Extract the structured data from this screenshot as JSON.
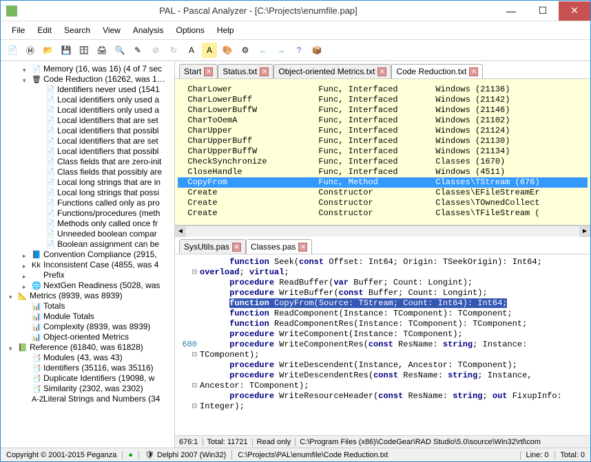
{
  "window": {
    "title": "PAL - Pascal Analyzer - [C:\\Projects\\enumfile.pap]"
  },
  "menu": [
    "File",
    "Edit",
    "Search",
    "View",
    "Analysis",
    "Options",
    "Help"
  ],
  "tree": [
    {
      "indent": 3,
      "toggle": "▾",
      "icon": "📄",
      "label": "Memory (16, was 16) (4 of 7 sec"
    },
    {
      "indent": 3,
      "toggle": "▾",
      "icon": "🗑",
      "label": "Code Reduction (16262, was 1…"
    },
    {
      "indent": 5,
      "toggle": "",
      "icon": "📄",
      "label": "Identifiers never used (1541"
    },
    {
      "indent": 5,
      "toggle": "",
      "icon": "📄",
      "label": "Local identifiers only used a"
    },
    {
      "indent": 5,
      "toggle": "",
      "icon": "📄",
      "label": "Local identifiers only used a"
    },
    {
      "indent": 5,
      "toggle": "",
      "icon": "📄",
      "label": "Local identifiers that are set"
    },
    {
      "indent": 5,
      "toggle": "",
      "icon": "📄",
      "label": "Local identifiers that possibl"
    },
    {
      "indent": 5,
      "toggle": "",
      "icon": "📄",
      "label": "Local identifiers that are set"
    },
    {
      "indent": 5,
      "toggle": "",
      "icon": "📄",
      "label": "Local identifiers that possibl"
    },
    {
      "indent": 5,
      "toggle": "",
      "icon": "📄",
      "label": "Class fields that are zero-init"
    },
    {
      "indent": 5,
      "toggle": "",
      "icon": "📄",
      "label": "Class fields that possibly are"
    },
    {
      "indent": 5,
      "toggle": "",
      "icon": "📄",
      "label": "Local long strings that are in"
    },
    {
      "indent": 5,
      "toggle": "",
      "icon": "📄",
      "label": "Local long strings that possi"
    },
    {
      "indent": 5,
      "toggle": "",
      "icon": "📄",
      "label": "Functions called only as pro"
    },
    {
      "indent": 5,
      "toggle": "",
      "icon": "📄",
      "label": "Functions/procedures (meth"
    },
    {
      "indent": 5,
      "toggle": "",
      "icon": "📄",
      "label": "Methods only called once fr"
    },
    {
      "indent": 5,
      "toggle": "",
      "icon": "📄",
      "label": "Unneeded boolean compar"
    },
    {
      "indent": 5,
      "toggle": "",
      "icon": "📄",
      "label": "Boolean assignment can be"
    },
    {
      "indent": 3,
      "toggle": "▸",
      "icon": "📘",
      "label": "Convention Compliance (2915,"
    },
    {
      "indent": 3,
      "toggle": "▸",
      "icon": "Kk",
      "label": "Inconsistent Case (4855, was 4"
    },
    {
      "indent": 3,
      "toggle": "▸",
      "icon": "",
      "label": "Prefix"
    },
    {
      "indent": 3,
      "toggle": "▸",
      "icon": "🌐",
      "label": "NextGen Readiness (5028, was"
    },
    {
      "indent": 1,
      "toggle": "▾",
      "icon": "📐",
      "label": "Metrics (8939, was 8939)"
    },
    {
      "indent": 3,
      "toggle": "",
      "icon": "📊",
      "label": "Totals"
    },
    {
      "indent": 3,
      "toggle": "",
      "icon": "📊",
      "label": "Module Totals"
    },
    {
      "indent": 3,
      "toggle": "",
      "icon": "📊",
      "label": "Complexity (8939, was 8939)"
    },
    {
      "indent": 3,
      "toggle": "",
      "icon": "📊",
      "label": "Object-oriented Metrics"
    },
    {
      "indent": 1,
      "toggle": "▾",
      "icon": "📗",
      "label": "Reference (61840, was 61828)"
    },
    {
      "indent": 3,
      "toggle": "",
      "icon": "📑",
      "label": "Modules (43, was 43)"
    },
    {
      "indent": 3,
      "toggle": "",
      "icon": "📑",
      "label": "Identifiers (35116, was 35116)"
    },
    {
      "indent": 3,
      "toggle": "",
      "icon": "📑",
      "label": "Duplicate Identifiers (19098, w"
    },
    {
      "indent": 3,
      "toggle": "",
      "icon": "📑",
      "label": "Similarity (2302, was 2302)"
    },
    {
      "indent": 3,
      "toggle": "",
      "icon": "A-Z",
      "label": "Literal Strings and Numbers (34"
    }
  ],
  "reportTabs": [
    {
      "label": "Start",
      "close": true,
      "active": false
    },
    {
      "label": "Status.txt",
      "close": true,
      "active": false
    },
    {
      "label": "Object-oriented Metrics.txt",
      "close": true,
      "active": false
    },
    {
      "label": "Code Reduction.txt",
      "close": true,
      "active": true
    }
  ],
  "report": [
    {
      "c1": "CharLower",
      "c2": "Func, Interfaced",
      "c3": "Windows (21136)",
      "sel": false
    },
    {
      "c1": "CharLowerBuff",
      "c2": "Func, Interfaced",
      "c3": "Windows (21142)",
      "sel": false
    },
    {
      "c1": "CharLowerBuffW",
      "c2": "Func, Interfaced",
      "c3": "Windows (21146)",
      "sel": false
    },
    {
      "c1": "CharToOemA",
      "c2": "Func, Interfaced",
      "c3": "Windows (21102)",
      "sel": false
    },
    {
      "c1": "CharUpper",
      "c2": "Func, Interfaced",
      "c3": "Windows (21124)",
      "sel": false
    },
    {
      "c1": "CharUpperBuff",
      "c2": "Func, Interfaced",
      "c3": "Windows (21130)",
      "sel": false
    },
    {
      "c1": "CharUpperBuffW",
      "c2": "Func, Interfaced",
      "c3": "Windows (21134)",
      "sel": false
    },
    {
      "c1": "CheckSynchronize",
      "c2": "Func, Interfaced",
      "c3": "Classes (1670)",
      "sel": false
    },
    {
      "c1": "CloseHandle",
      "c2": "Func, Interfaced",
      "c3": "Windows (4511)",
      "sel": false
    },
    {
      "c1": "CopyFrom",
      "c2": "Func, Method",
      "c3": "Classes\\TStream (676)",
      "sel": true
    },
    {
      "c1": "Create",
      "c2": "Constructor",
      "c3": "Classes\\EFileStreamEr",
      "sel": false
    },
    {
      "c1": "Create",
      "c2": "Constructor",
      "c3": "Classes\\TOwnedCollect",
      "sel": false
    },
    {
      "c1": "Create",
      "c2": "Constructor",
      "c3": "Classes\\TFileStream (",
      "sel": false
    }
  ],
  "srcTabs": [
    {
      "label": "SysUtils.pas",
      "close": true,
      "active": false
    },
    {
      "label": "Classes.pas",
      "close": true,
      "active": true
    }
  ],
  "srcStatus": {
    "pos": "676:1",
    "total": "Total: 11721",
    "mode": "Read only",
    "path": "C:\\Program Files (x86)\\CodeGear\\RAD Studio\\5.0\\source\\Win32\\rtl\\com"
  },
  "status": {
    "copyright": "Copyright © 2001-2015 Peganza",
    "compiler": "Delphi 2007 (Win32)",
    "path": "C:\\Projects\\PAL\\enumfile\\Code Reduction.txt",
    "line": "Line: 0",
    "total": "Total: 0"
  }
}
